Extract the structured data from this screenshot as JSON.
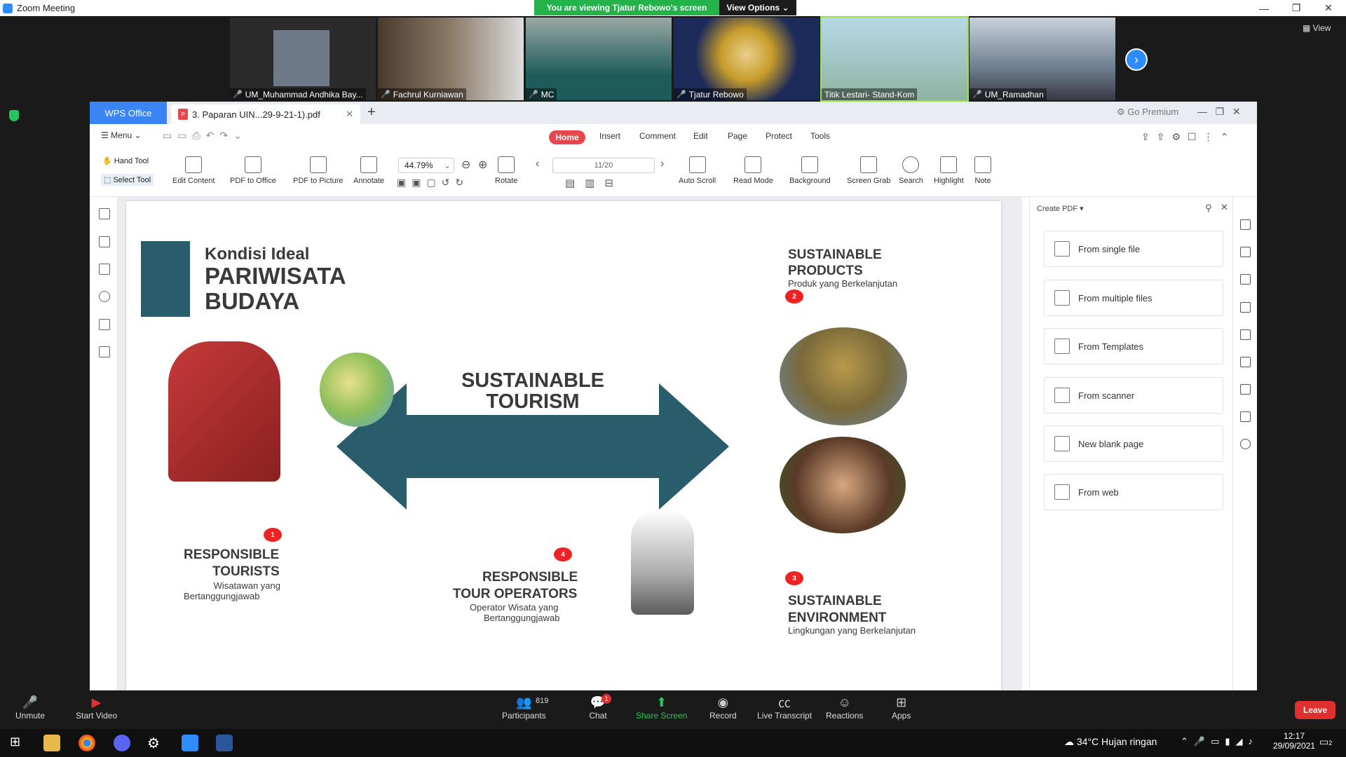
{
  "zoom": {
    "title": "Zoom Meeting",
    "banner": "You are viewing Tjatur Rebowo's screen",
    "view_options": "View Options",
    "view": "View",
    "participants": [
      "UM_Muhammad Andhika Bay...",
      "Fachrul Kurniawan",
      "MC",
      "Tjatur Rebowo",
      "Titik Lestari- Stand-Kom",
      "UM_Ramadhan"
    ],
    "controls": {
      "unmute": "Unmute",
      "start_video": "Start Video",
      "participants": "Participants",
      "participants_count": "819",
      "chat": "Chat",
      "chat_badge": "1",
      "share": "Share Screen",
      "record": "Record",
      "transcript": "Live Transcript",
      "reactions": "Reactions",
      "apps": "Apps",
      "leave": "Leave"
    }
  },
  "wps": {
    "office_tab": "WPS Office",
    "doc_tab": "3. Paparan UIN...29-9-21-1).pdf",
    "go_premium": "Go Premium",
    "menu": "Menu",
    "tabs": [
      "Home",
      "Insert",
      "Comment",
      "Edit",
      "Page",
      "Protect",
      "Tools"
    ],
    "tools": {
      "hand": "Hand Tool",
      "select": "Select Tool",
      "edit_content": "Edit Content",
      "pdf_office": "PDF to Office",
      "pdf_picture": "PDF to Picture",
      "annotate": "Annotate",
      "zoom": "44.79%",
      "rotate": "Rotate",
      "page": "11/20",
      "auto_scroll": "Auto Scroll",
      "read_mode": "Read Mode",
      "background": "Background",
      "screen_grab": "Screen Grab",
      "search": "Search",
      "highlight": "Highlight",
      "note": "Note"
    },
    "create_pdf": {
      "title": "Create PDF",
      "items": [
        "From single file",
        "From multiple files",
        "From Templates",
        "From scanner",
        "New blank page",
        "From web"
      ]
    }
  },
  "slide": {
    "kondisi": "Kondisi Ideal",
    "pariwisata": "PARIWISATA",
    "budaya": "BUDAYA",
    "center1": "SUSTAINABLE",
    "center2": "TOURISM",
    "sp1": "SUSTAINABLE",
    "sp2": "PRODUCTS",
    "sp_sub": "Produk yang Berkelanjutan",
    "rt1": "RESPONSIBLE",
    "rt2": "TOURISTS",
    "rt_sub1": "Wisatawan yang",
    "rt_sub2": "Bertanggungjawab",
    "ro1": "RESPONSIBLE",
    "ro2": "TOUR OPERATORS",
    "ro_sub1": "Operator Wisata yang",
    "ro_sub2": "Bertanggungjawab",
    "se1": "SUSTAINABLE",
    "se2": "ENVIRONMENT",
    "se_sub": "Lingkungan yang Berkelanjutan",
    "badges": [
      "1",
      "2",
      "3",
      "4"
    ]
  },
  "taskbar": {
    "weather": "34°C  Hujan ringan",
    "time": "12:17",
    "date": "29/09/2021",
    "notif": "2"
  },
  "colors": {
    "arrow": "#2a5d6b",
    "square": "#2a5d6b",
    "badge": "#e22222",
    "wps_blue": "#3a84f6",
    "zoom_blue": "#2d8cff",
    "zoom_green": "#24b24b"
  }
}
